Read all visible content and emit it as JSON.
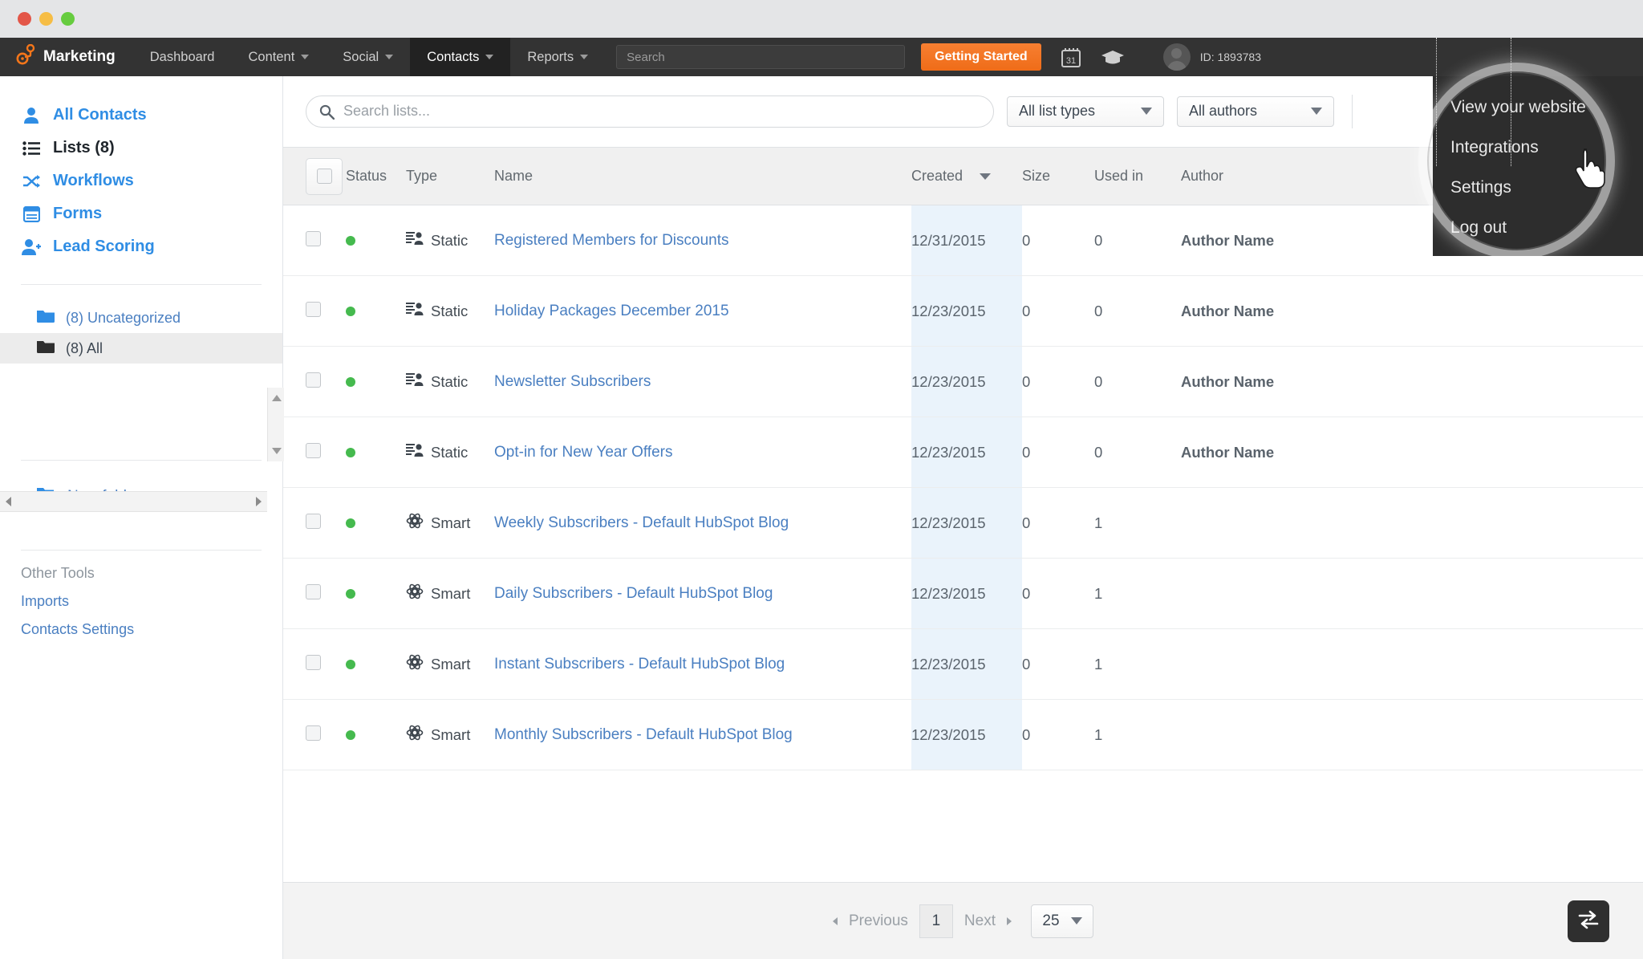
{
  "window": {
    "controls": [
      "close",
      "minimize",
      "maximize"
    ]
  },
  "navbar": {
    "brand": "Marketing",
    "items": [
      {
        "label": "Dashboard",
        "has_caret": false,
        "active": false
      },
      {
        "label": "Content",
        "has_caret": true,
        "active": false
      },
      {
        "label": "Social",
        "has_caret": true,
        "active": false
      },
      {
        "label": "Contacts",
        "has_caret": true,
        "active": true
      },
      {
        "label": "Reports",
        "has_caret": true,
        "active": false
      }
    ],
    "search_placeholder": "Search",
    "search_value": "",
    "getting_started_label": "Getting Started",
    "calendar_icon_label": "31",
    "account_id": "ID: 1893783"
  },
  "account_menu": {
    "items": [
      {
        "label": "View your website"
      },
      {
        "label": "Integrations"
      },
      {
        "label": "Settings"
      },
      {
        "label": "Log out"
      }
    ]
  },
  "sidebar": {
    "nav": [
      {
        "label": "All Contacts",
        "icon": "person-icon",
        "current": false
      },
      {
        "label": "Lists (8)",
        "icon": "list-icon",
        "current": true
      },
      {
        "label": "Workflows",
        "icon": "shuffle-icon",
        "current": false
      },
      {
        "label": "Forms",
        "icon": "form-icon",
        "current": false
      },
      {
        "label": "Lead Scoring",
        "icon": "person-plus-icon",
        "current": false
      }
    ],
    "folders": [
      {
        "label": "(8) Uncategorized",
        "selected": false
      },
      {
        "label": "(8) All",
        "selected": true
      }
    ],
    "new_folder_label": "New folder",
    "other_tools_label": "Other Tools",
    "other_tools": [
      {
        "label": "Imports"
      },
      {
        "label": "Contacts Settings"
      }
    ]
  },
  "toolbar": {
    "search_placeholder": "Search lists...",
    "search_value": "",
    "list_types_label": "All list types",
    "authors_label": "All authors"
  },
  "table": {
    "columns": {
      "status": "Status",
      "type": "Type",
      "name": "Name",
      "created": "Created",
      "size": "Size",
      "used_in": "Used in",
      "author": "Author"
    },
    "sorted_by": "Created",
    "rows": [
      {
        "status": "active",
        "type": "Static",
        "name": "Registered Members for Discounts",
        "created": "12/31/2015",
        "size": "0",
        "used_in": "0",
        "author": "Author Name"
      },
      {
        "status": "active",
        "type": "Static",
        "name": "Holiday Packages December 2015",
        "created": "12/23/2015",
        "size": "0",
        "used_in": "0",
        "author": "Author Name"
      },
      {
        "status": "active",
        "type": "Static",
        "name": "Newsletter Subscribers",
        "created": "12/23/2015",
        "size": "0",
        "used_in": "0",
        "author": "Author Name"
      },
      {
        "status": "active",
        "type": "Static",
        "name": "Opt-in for New Year Offers",
        "created": "12/23/2015",
        "size": "0",
        "used_in": "0",
        "author": "Author Name"
      },
      {
        "status": "active",
        "type": "Smart",
        "name": "Weekly Subscribers - Default HubSpot Blog",
        "created": "12/23/2015",
        "size": "0",
        "used_in": "1",
        "author": ""
      },
      {
        "status": "active",
        "type": "Smart",
        "name": "Daily Subscribers - Default HubSpot Blog",
        "created": "12/23/2015",
        "size": "0",
        "used_in": "1",
        "author": ""
      },
      {
        "status": "active",
        "type": "Smart",
        "name": "Instant Subscribers - Default HubSpot Blog",
        "created": "12/23/2015",
        "size": "0",
        "used_in": "1",
        "author": ""
      },
      {
        "status": "active",
        "type": "Smart",
        "name": "Monthly Subscribers - Default HubSpot Blog",
        "created": "12/23/2015",
        "size": "0",
        "used_in": "1",
        "author": ""
      }
    ]
  },
  "footer": {
    "previous_label": "Previous",
    "page_number": "1",
    "next_label": "Next",
    "per_page": "25"
  },
  "colors": {
    "brand_orange": "#ef6c18",
    "link_blue": "#4a7fc1",
    "nav_dark": "#333333",
    "status_green": "#45ba4e",
    "sorted_column": "#eaf3fb"
  }
}
